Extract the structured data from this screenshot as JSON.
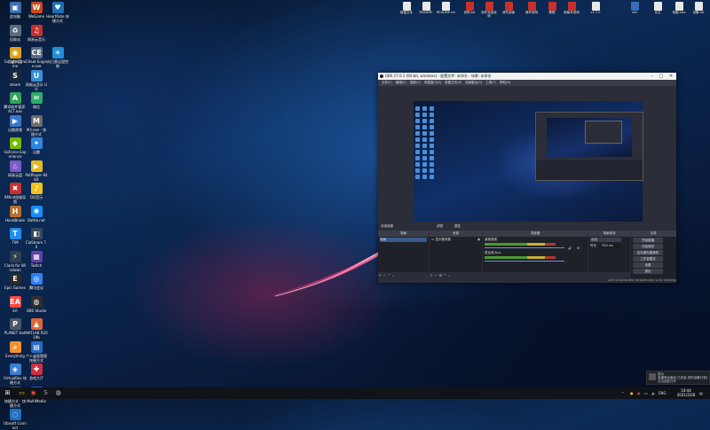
{
  "desktop": {
    "icons": [
      {
        "name": "recycle-bin-icon",
        "label": "此电脑",
        "glyph": "▣",
        "color": "#3c6fb0"
      },
      {
        "name": "wegame-icon",
        "label": "WeGame",
        "glyph": "W",
        "color": "#c84a1e"
      },
      {
        "name": "heartrate-icon",
        "label": "HeartRate 快捷方式",
        "glyph": "♥",
        "color": "#1f6fb5"
      },
      {
        "name": "network-icon",
        "label": "回收站",
        "glyph": "♻",
        "color": "#5a6b7d"
      },
      {
        "name": "cloud-music-icon",
        "label": "网易云音乐",
        "glyph": "♫",
        "color": "#c62f2f"
      },
      {
        "name": "drive-icon",
        "label": "百度网盘",
        "glyph": "☁",
        "color": "#2b7cd3"
      },
      {
        "name": "chrome-icon",
        "label": "Google Chrome",
        "glyph": "◉",
        "color": "#d9a21b"
      },
      {
        "name": "cheat-engine-icon",
        "label": "Cheat Engine.exe",
        "glyph": "CE",
        "color": "#586b82"
      },
      {
        "name": "remote-icon",
        "label": "向日葵远程控制",
        "glyph": "☀",
        "color": "#1f8fd6"
      },
      {
        "name": "steam-icon",
        "label": "steam",
        "glyph": "S",
        "color": "#1b2838"
      },
      {
        "name": "qq-music-icon",
        "label": "网易云音乐 UU",
        "glyph": "U",
        "color": "#3a8fd8"
      },
      {
        "name": "software-icon",
        "label": "腾讯软件管家-ACT.exe",
        "glyph": "A",
        "color": "#2fa35a"
      },
      {
        "name": "wechat-icon",
        "label": "微信",
        "glyph": "✉",
        "color": "#2aae67"
      },
      {
        "name": "ppt-icon",
        "label": "迅雷视频",
        "glyph": "▶",
        "color": "#3d77c7"
      },
      {
        "name": "m3-icon",
        "label": "M3.exe - 快捷方式",
        "glyph": "M",
        "color": "#6c6c6c"
      },
      {
        "name": "geforce-icon",
        "label": "GeForce Experience",
        "glyph": "◆",
        "color": "#76b900"
      },
      {
        "name": "gift-icon",
        "label": "迅雷",
        "glyph": "✦",
        "color": "#2e86de"
      },
      {
        "name": "tencent-icon",
        "label": "网易云盘",
        "glyph": "♨",
        "color": "#7a5ac8"
      },
      {
        "name": "potplayer-icon",
        "label": "PotPlayer 64 bit",
        "glyph": "▶",
        "color": "#e5b91e"
      },
      {
        "name": "xmind-icon",
        "label": "XMind思维导图",
        "glyph": "✖",
        "color": "#c8322c"
      },
      {
        "name": "qq-icon",
        "label": "QQ音乐",
        "glyph": "♪",
        "color": "#f2c21b"
      },
      {
        "name": "handbrake-icon",
        "label": "HandBrake",
        "glyph": "H",
        "color": "#b76f2b"
      },
      {
        "name": "battlenet-icon",
        "label": "Battle.net",
        "glyph": "✺",
        "color": "#148eff"
      },
      {
        "name": "tim-icon",
        "label": "TIM",
        "glyph": "T",
        "color": "#1d8ff0"
      },
      {
        "name": "clashsteam-icon",
        "label": "ClaSteam 7.0",
        "glyph": "◧",
        "color": "#34495e"
      },
      {
        "name": "clash-icon",
        "label": "Clash for Windows",
        "glyph": "⚡",
        "color": "#2f3e4f"
      },
      {
        "name": "twitch-icon",
        "label": "Twitch",
        "glyph": "▦",
        "color": "#6441a5"
      },
      {
        "name": "epic-icon",
        "label": "Epic Games",
        "glyph": "E",
        "color": "#2a2a2a"
      },
      {
        "name": "apex-icon",
        "label": "腾讯会议",
        "glyph": "◎",
        "color": "#2d7ff9"
      },
      {
        "name": "ea-icon",
        "label": "EA",
        "glyph": "EA",
        "color": "#ff4747"
      },
      {
        "name": "obs-icon",
        "label": "OBS Studio",
        "glyph": "◍",
        "color": "#302e31"
      },
      {
        "name": "plus-icon",
        "label": "PLANET Hall",
        "glyph": "P",
        "color": "#4b5966"
      },
      {
        "name": "matlab-icon",
        "label": "MATLAB R2019b",
        "glyph": "▲",
        "color": "#e16737"
      },
      {
        "name": "everything-icon",
        "label": "Everything",
        "glyph": "⌕",
        "color": "#f29330"
      },
      {
        "name": "personal-icon",
        "label": "个人桌面管理 快捷方式",
        "glyph": "▤",
        "color": "#2a6bc2"
      },
      {
        "name": "virtualbox-icon",
        "label": "VirtualBox 快捷方式",
        "glyph": "◈",
        "color": "#3a7fd0"
      },
      {
        "name": "game-icon",
        "label": "游戏大厅",
        "glyph": "✚",
        "color": "#cf2e3e"
      },
      {
        "name": "shortcut-icon",
        "label": "快捷方式 - 快捷方式",
        "glyph": "≡",
        "color": "#3b4f66"
      },
      {
        "name": "multi-icon",
        "label": "MultiMedia",
        "glyph": "◐",
        "color": "#2c5aa0"
      },
      {
        "name": "ubisoft-icon",
        "label": "Ubisoft Connect",
        "glyph": "◌",
        "color": "#1f70c1"
      }
    ],
    "top_icons": [
      {
        "name": "doc-icon",
        "label": "新建文本",
        "color": "#e8e8e8"
      },
      {
        "name": "doc-icon-2",
        "label": "README",
        "color": "#e8e8e8"
      },
      {
        "name": "doc-icon-3",
        "label": "README.txt",
        "color": "#e8e8e8"
      },
      {
        "name": "pdf-icon",
        "label": "说明.txt",
        "color": "#c9302c"
      },
      {
        "name": "pdf-icon-2",
        "label": "软件安装说明",
        "color": "#c9302c"
      },
      {
        "name": "pdf-icon-3",
        "label": "请先阅读",
        "color": "#c9302c"
      },
      {
        "name": "pdf-icon-4",
        "label": "操作说明",
        "color": "#c9302c"
      },
      {
        "name": "pdf-icon-5",
        "label": "教程",
        "color": "#c9302c"
      },
      {
        "name": "pdf-icon-6",
        "label": "新版本说明",
        "color": "#c9302c"
      },
      {
        "name": "file-icon",
        "label": "v1.7.0",
        "color": "#e8e8e8"
      },
      {
        "name": "folder-icon",
        "label": "skn",
        "color": "#3a6fb7"
      },
      {
        "name": "doc-icon-4",
        "label": "论文",
        "color": "#e8e8e8"
      },
      {
        "name": "doc-icon-5",
        "label": "电脑.xlsx",
        "color": "#e8e8e8"
      },
      {
        "name": "doc-icon-6",
        "label": "设备.txt",
        "color": "#e8e8e8"
      }
    ]
  },
  "obs": {
    "title": "OBS 27.0.1 (64-bit, windows) - 配置文件: 未命名 - 场景: 未命名",
    "menu": [
      "文件(F)",
      "编辑(E)",
      "视图(V)",
      "停靠窗口(D)",
      "配置文件(P)",
      "场景集合(S)",
      "工具(T)",
      "帮助(H)"
    ],
    "dock_bar": {
      "filter": "滤镜",
      "properties": "属性"
    },
    "docks": {
      "scenes": {
        "title": "场景",
        "items": [
          "场景"
        ]
      },
      "sources": {
        "title": "来源",
        "items": [
          "显示器采集"
        ]
      },
      "mixer": {
        "title": "混音器",
        "track1": "桌面音频",
        "track2": "麦克风/Aux"
      },
      "transitions": {
        "title": "场景转场",
        "type": "淡出",
        "duration_label": "时长",
        "duration": "300 ms"
      },
      "controls": {
        "title": "控件",
        "buttons": [
          "开始直播",
          "开始录制",
          "启动虚拟摄像机",
          "工作室模式",
          "设置",
          "退出"
        ]
      }
    },
    "status": "LIVE: 00:00:00    REC: 00:00:00    CPU: 1.1%, 30.00 fps"
  },
  "taskbar": {
    "start_glyph": "⊞",
    "pinned": [
      "file-explorer-icon",
      "chrome-icon",
      "steam-icon",
      "obs-icon"
    ],
    "pinned_glyphs": [
      "▭",
      "◉",
      "S",
      "◍"
    ],
    "pinned_colors": [
      "#f2c21b",
      "#e74c3c",
      "#9fb3c8",
      "#cfcfcf"
    ],
    "tray_text": "ENG",
    "time": "14:44",
    "date": "2021/2/26"
  },
  "toast": {
    "line1": "提示",
    "line2": "高通骁龙驱动 已安装 您的设备已就绪",
    "line3": "点击此处打开"
  }
}
